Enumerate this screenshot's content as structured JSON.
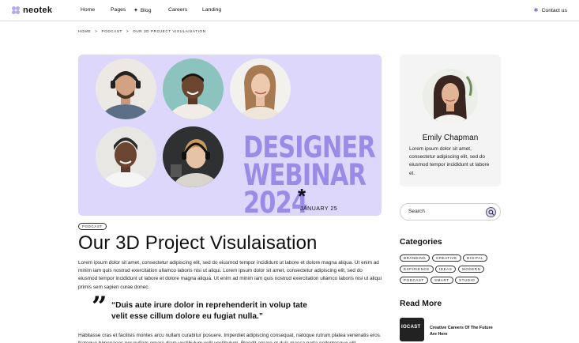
{
  "header": {
    "logo_text": "neotek",
    "nav": [
      {
        "label": "Home"
      },
      {
        "label": "Pages"
      },
      {
        "label": "Blog"
      },
      {
        "label": "Careers"
      },
      {
        "label": "Landing"
      }
    ],
    "contact_label": "Contact us"
  },
  "breadcrumb": {
    "home": "HOME",
    "sep": ">",
    "section": "PODCAST",
    "current": "OUR 3D PROJECT VISULAISATION"
  },
  "hero": {
    "line1": "DESIGNER",
    "line2": "WEBINAR",
    "line3": "2024",
    "asterisk": "*",
    "date": "JANUARY 25",
    "background": "#dcd7fb",
    "accent": "#9b8ae6"
  },
  "article": {
    "tag": "PODCAST",
    "title": "Our 3D Project Visulaisation",
    "paragraph": "Lorem ipsum dolor sit amet, consectetur adipiscing elit, sed do eiusmod tempor incididunt ut labore et dolore magna aliqua. Ut enim ad minim iam quis nostrud exercitation ullamco laboris nisi ut aliqui. Lorem ipsum dolor sit amet, consectetur adipiscing elit, sed do eiusmod tempor incididunt ut labore et dolore magna aliqua. Ut enim ad minim iam quis nostrud exercitation ullamco laboris nisi ut aliqui primis sem sapien curae donec.",
    "quote_mark": "”",
    "quote": "“Duis aute irure dolor in reprehenderit in volup tate velit esse cillum dolore eu fugiat nulla.”",
    "paragraph2": "Habitasse cras et facilisis montes arcu nullam curabitur posuere. Imperdiet adipiscing consequat, natoque rutrum platea venenatis eros. Natoque himenaeos per nullam ornare diam vestibulum velit vestibulum. Blandit ornare et duis massa porta pellentesque elit."
  },
  "sidebar": {
    "author": {
      "name": "Emily Chapman",
      "bio": "Lorem ipsum dolor sit amet, consectetur adipiscing elit, sed do eiusmod tempor incididunt ut labore et."
    },
    "search_placeholder": "Search",
    "categories_heading": "Categories",
    "categories": [
      "BRANDING",
      "CREATIVE",
      "DIGITAL",
      "EXPIRIENCE",
      "IDEAS",
      "MODERN",
      "PODCAST",
      "SMART",
      "STUDIO"
    ],
    "read_more_heading": "Read More",
    "read_more": [
      {
        "thumb_text": "IOCAST",
        "title": "Creative Careers Of The Future Are Here"
      }
    ]
  }
}
